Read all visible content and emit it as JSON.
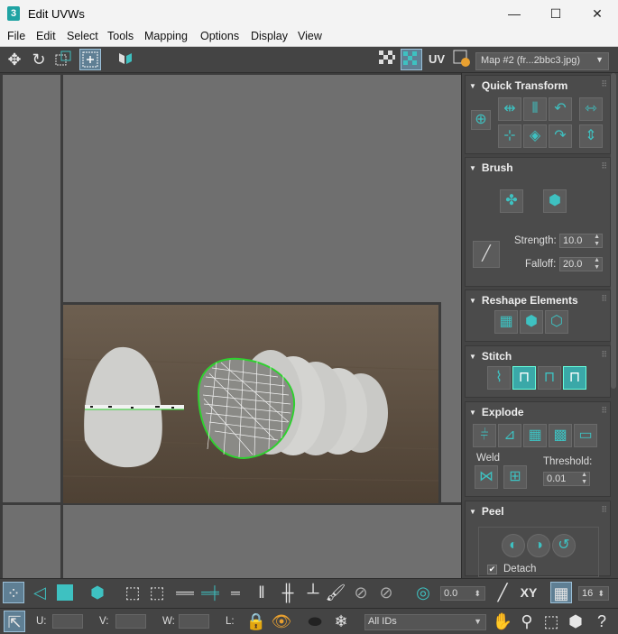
{
  "window": {
    "app_icon": "3",
    "title": "Edit UVWs",
    "minimize": "—",
    "maximize": "☐",
    "close": "✕"
  },
  "menu": [
    "File",
    "Edit",
    "Select",
    "Tools",
    "Mapping",
    "Options",
    "Display",
    "View"
  ],
  "toolbar_top": {
    "uv_label": "UV",
    "map_select": "Map #2 (fr...2bbc3.jpg)"
  },
  "panel": {
    "quick_transform": {
      "title": "Quick Transform"
    },
    "brush": {
      "title": "Brush",
      "strength_label": "Strength:",
      "strength_value": "10.0",
      "falloff_label": "Falloff:",
      "falloff_value": "20.0"
    },
    "reshape": {
      "title": "Reshape Elements"
    },
    "stitch": {
      "title": "Stitch"
    },
    "explode": {
      "title": "Explode",
      "weld_label": "Weld",
      "threshold_label": "Threshold:",
      "threshold_value": "0.01"
    },
    "peel": {
      "title": "Peel",
      "detach_label": "Detach",
      "detach_checked": true
    }
  },
  "bottom_toolbar": {
    "angle_value": "0.0",
    "xy_label": "XY",
    "grid_value": "16"
  },
  "status": {
    "u_label": "U:",
    "u_value": "",
    "v_label": "V:",
    "v_value": "",
    "w_label": "W:",
    "w_value": "",
    "l_label": "L:",
    "ids_select": "All IDs"
  },
  "colors": {
    "accent": "#3ec1c1",
    "selection_green": "#2fd02f",
    "panel_bg": "#444444",
    "viewport_bg": "#6f6f6f"
  }
}
